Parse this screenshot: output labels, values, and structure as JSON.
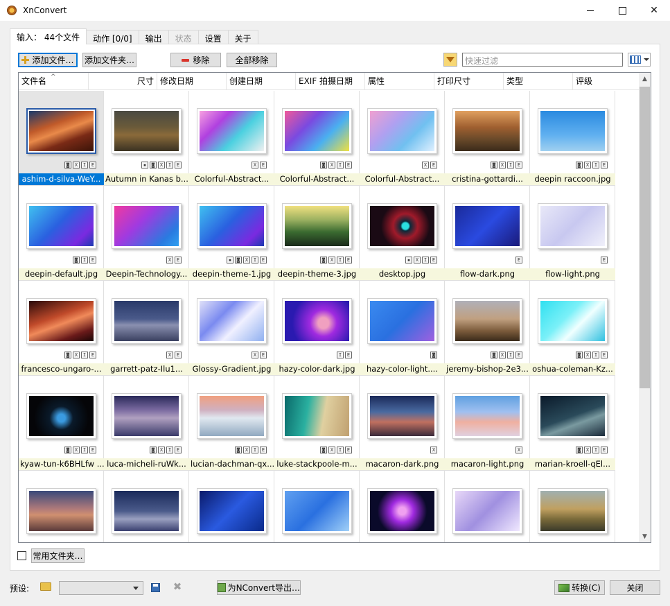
{
  "window": {
    "title": "XnConvert"
  },
  "tabs": [
    {
      "label": "输入： 44个文件",
      "active": true,
      "disabled": false
    },
    {
      "label": "动作 [0/0]",
      "active": false,
      "disabled": false
    },
    {
      "label": "输出",
      "active": false,
      "disabled": false
    },
    {
      "label": "状态",
      "active": false,
      "disabled": true
    },
    {
      "label": "设置",
      "active": false,
      "disabled": false
    },
    {
      "label": "关于",
      "active": false,
      "disabled": false
    }
  ],
  "toolbar": {
    "add_files": "添加文件…",
    "add_folder": "添加文件夹…",
    "remove": "移除",
    "remove_all": "全部移除",
    "filter_placeholder": "快速过滤"
  },
  "columns": [
    "文件名",
    "尺寸",
    "修改日期",
    "创建日期",
    "EXIF 拍摄日期",
    "属性",
    "打印尺寸",
    "类型",
    "评级"
  ],
  "files": [
    {
      "name": "ashim-d-silva-WeY...",
      "badges": [
        "◙",
        "X",
        "I",
        "E"
      ],
      "selected": true,
      "bg": "linear-gradient(160deg,#1a3a6b 0%,#c05a2a 35%,#e98a4a 50%,#7a2a16 70%,#3a1408 100%)"
    },
    {
      "name": "Autumn in Kanas b...",
      "badges": [
        "▪",
        "◙",
        "X",
        "I",
        "E"
      ],
      "bg": "linear-gradient(180deg,#4a4a42 0%,#6a5a3a 40%,#8a6a3a 60%,#3a3222 100%)"
    },
    {
      "name": "Colorful-Abstract...",
      "badges": [
        "X",
        "E"
      ],
      "bg": "linear-gradient(135deg,#f7a0e0 0%,#b040e0 30%,#4ad0e0 60%,#f0f0f0 100%)"
    },
    {
      "name": "Colorful-Abstract...",
      "badges": [
        "◙",
        "X",
        "I",
        "E"
      ],
      "bg": "linear-gradient(135deg,#f05a9a 0%,#7a4ae0 35%,#4ab0f0 65%,#f0e040 100%)"
    },
    {
      "name": "Colorful-Abstract...",
      "badges": [
        "X",
        "E"
      ],
      "bg": "linear-gradient(135deg,#f0a0d0 0%,#b0a0f0 35%,#70c0f0 65%,#e0f0ff 100%)"
    },
    {
      "name": "cristina-gottardi...",
      "badges": [
        "◙",
        "X",
        "I",
        "E"
      ],
      "bg": "linear-gradient(180deg,#e0a060 0%,#a06030 40%,#6a4a2a 70%,#3a2a1a 100%)"
    },
    {
      "name": "deepin raccoon.jpg",
      "badges": [
        "◙",
        "X",
        "I",
        "E"
      ],
      "bg": "linear-gradient(180deg,#2a8ae0 0%,#60b0f0 60%,#a0d0f0 100%)"
    },
    {
      "name": "deepin-default.jpg",
      "badges": [
        "◙",
        "I",
        "E"
      ],
      "bg": "linear-gradient(135deg,#40c0f0 0%,#2a60e0 45%,#7a2ae0 80%,#1a3ab0 100%)"
    },
    {
      "name": "Deepin-Technology...",
      "badges": [
        "X",
        "E"
      ],
      "bg": "linear-gradient(135deg,#f03aa0 0%,#a03ae0 40%,#2a7ae0 80%,#30a0f0 100%)"
    },
    {
      "name": "deepin-theme-1.jpg",
      "badges": [
        "▪",
        "◙",
        "X",
        "I",
        "E"
      ],
      "bg": "linear-gradient(135deg,#40c0f0 0%,#2a60e0 45%,#7a2ae0 80%,#1a3ab0 100%)"
    },
    {
      "name": "deepin-theme-3.jpg",
      "badges": [
        "◙",
        "X",
        "I",
        "E"
      ],
      "bg": "linear-gradient(180deg,#f0e080 0%,#9ab060 35%,#3a6a30 65%,#1a2a1a 100%)"
    },
    {
      "name": "desktop.jpg",
      "badges": [
        "▪",
        "X",
        "I",
        "E"
      ],
      "bg": "radial-gradient(circle at 55% 50%,#2ae0e0 0 8%,#0a2a3a 12%,#a01a2a 30%,#1a0a14 60%)"
    },
    {
      "name": "flow-dark.png",
      "badges": [
        "E"
      ],
      "bg": "linear-gradient(135deg,#1a2a9a 0%,#2a4ae0 50%,#1a1a7a 100%)"
    },
    {
      "name": "flow-light.png",
      "badges": [
        "E"
      ],
      "bg": "linear-gradient(135deg,#e8e8f8 0%,#c8c8f0 50%,#f0f0fa 100%)"
    },
    {
      "name": "francesco-ungaro-...",
      "badges": [
        "◙",
        "X",
        "I",
        "E"
      ],
      "bg": "linear-gradient(160deg,#2a0a0a 0%,#c04a2a 40%,#f08a5a 55%,#6a1a1a 80%,#1a0606 100%)"
    },
    {
      "name": "garrett-patz-Ilu1...",
      "badges": [
        "X",
        "E"
      ],
      "bg": "linear-gradient(180deg,#2a3a6a 0%,#4a5a8a 45%,#8a90b0 60%,#3a4060 100%)"
    },
    {
      "name": "Glossy-Gradient.jpg",
      "badges": [
        "X",
        "E"
      ],
      "bg": "linear-gradient(135deg,#e0e0f8 0%,#7a8af0 35%,#f0f0ff 60%,#90b0f0 100%)"
    },
    {
      "name": "hazy-color-dark.jpg",
      "badges": [
        "I",
        "E"
      ],
      "bg": "radial-gradient(circle at 60% 55%,#f0a0c0 0 12%,#a02ae0 30%,#2a1ab0 70%)"
    },
    {
      "name": "hazy-color-light....",
      "badges": [
        "◙"
      ],
      "bg": "linear-gradient(135deg,#3a8af0 0%,#2a70e0 50%,#a060e0 100%)"
    },
    {
      "name": "jeremy-bishop-2e3...",
      "badges": [
        "◙",
        "X",
        "I",
        "E"
      ],
      "bg": "linear-gradient(180deg,#b0b0b8 0%,#c0a080 45%,#7a5a3a 75%,#3a2a1a 100%)"
    },
    {
      "name": "oshua-coleman-Kz...",
      "badges": [
        "◙",
        "X",
        "I",
        "E"
      ],
      "bg": "linear-gradient(135deg,#30e0f0 0%,#7af0f8 40%,#f0ffff 60%,#30c0e0 100%)"
    },
    {
      "name": "kyaw-tun-k6BHLfw ...",
      "badges": [
        "◙",
        "X",
        "I",
        "E"
      ],
      "bg": "radial-gradient(circle at 50% 55%,#3a9ae0 0 10%,#0a1a2a 30%,#050508 70%)"
    },
    {
      "name": "luca-micheli-ruWk...",
      "badges": [
        "◙",
        "X",
        "I",
        "E"
      ],
      "bg": "linear-gradient(180deg,#2a2a5a 0%,#7a6aa0 35%,#b0a0c0 55%,#3a3a6a 100%)"
    },
    {
      "name": "lucian-dachman-qx...",
      "badges": [
        "◙",
        "X",
        "I",
        "E"
      ],
      "bg": "linear-gradient(180deg,#f0a080 0%,#d0b0c0 35%,#e0e8f0 55%,#90a8c0 100%)"
    },
    {
      "name": "luke-stackpoole-m...",
      "badges": [
        "◙",
        "X",
        "I",
        "E"
      ],
      "bg": "linear-gradient(100deg,#0a6a6a 0%,#2ab0a0 35%,#e0d0a0 60%,#c0a070 100%)"
    },
    {
      "name": "macaron-dark.png",
      "badges": [
        "X"
      ],
      "bg": "linear-gradient(180deg,#1a2a5a 0%,#4a6aa0 40%,#c07060 65%,#3a2a3a 100%)"
    },
    {
      "name": "macaron-light.png",
      "badges": [
        "X"
      ],
      "bg": "linear-gradient(180deg,#60a0e0 0%,#a0c0f0 40%,#f0b0a0 65%,#e0d0e0 100%)"
    },
    {
      "name": "marian-kroell-qEl...",
      "badges": [
        "◙",
        "X",
        "I",
        "E"
      ],
      "bg": "linear-gradient(160deg,#0a1a2a 0%,#2a4a5a 50%,#7a9aa0 65%,#1a2a3a 100%)"
    },
    {
      "name": "",
      "badges": [],
      "bg": "linear-gradient(180deg,#3a4a7a 0%,#b07a7a 45%,#d09070 60%,#5a3a3a 100%)"
    },
    {
      "name": "",
      "badges": [],
      "bg": "linear-gradient(180deg,#1a2a5a 0%,#4a5a8a 50%,#9aa0c0 70%,#3a4070 100%)"
    },
    {
      "name": "",
      "badges": [],
      "bg": "linear-gradient(135deg,#0a1a6a 0%,#2a5ae0 50%,#0a2a8a 100%)"
    },
    {
      "name": "",
      "badges": [],
      "bg": "linear-gradient(135deg,#60a0f0 0%,#2a70e0 50%,#a0d0f8 100%)"
    },
    {
      "name": "",
      "badges": [],
      "bg": "radial-gradient(circle at 50% 50%,#f0a0f0 0 10%,#a02ae0 30%,#0a0a2a 65%)"
    },
    {
      "name": "",
      "badges": [],
      "bg": "linear-gradient(135deg,#e8d8f8 0%,#a090e0 50%,#f0e8ff 100%)"
    },
    {
      "name": "",
      "badges": [],
      "bg": "linear-gradient(180deg,#a0b0b0 0%,#c0a060 45%,#7a6a3a 70%,#3a3a2a 100%)"
    }
  ],
  "bottom": {
    "common_folder": "常用文件夹…",
    "preset_label": "预设:",
    "export_button": "为NConvert导出…",
    "convert_button": "转换(C)",
    "close_button": "关闭"
  },
  "colors": {
    "selection": "#0078d7",
    "accent_border": "#0078d7"
  }
}
